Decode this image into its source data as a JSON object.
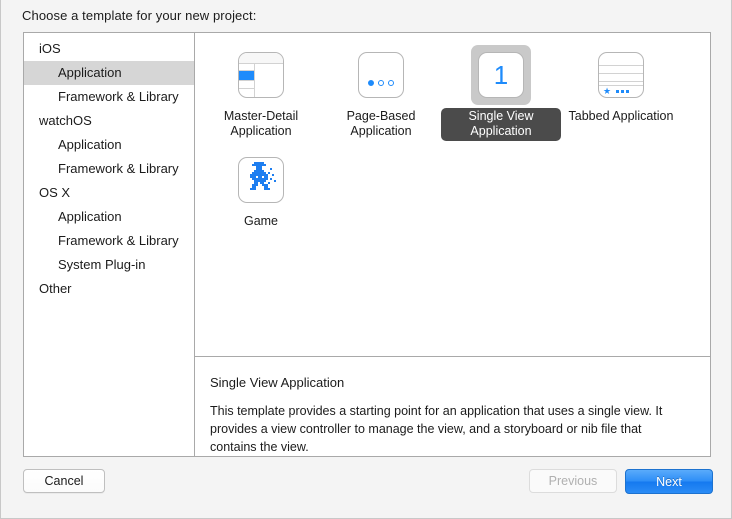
{
  "dialog": {
    "prompt": "Choose a template for your new project:"
  },
  "sidebar": {
    "items": [
      {
        "label": "iOS",
        "level": "group",
        "selected": false
      },
      {
        "label": "Application",
        "level": "child",
        "selected": true
      },
      {
        "label": "Framework & Library",
        "level": "child",
        "selected": false
      },
      {
        "label": "watchOS",
        "level": "group",
        "selected": false
      },
      {
        "label": "Application",
        "level": "child",
        "selected": false
      },
      {
        "label": "Framework & Library",
        "level": "child",
        "selected": false
      },
      {
        "label": "OS X",
        "level": "group",
        "selected": false
      },
      {
        "label": "Application",
        "level": "child",
        "selected": false
      },
      {
        "label": "Framework & Library",
        "level": "child",
        "selected": false
      },
      {
        "label": "System Plug-in",
        "level": "child",
        "selected": false
      },
      {
        "label": "Other",
        "level": "group",
        "selected": false
      }
    ]
  },
  "templates": [
    {
      "label": "Master-Detail Application",
      "icon": "master-detail-icon",
      "selected": false
    },
    {
      "label": "Page-Based Application",
      "icon": "page-based-icon",
      "selected": false
    },
    {
      "label": "Single View Application",
      "icon": "single-view-icon",
      "selected": true
    },
    {
      "label": "Tabbed Application",
      "icon": "tabbed-icon",
      "selected": false
    },
    {
      "label": "Game",
      "icon": "game-icon",
      "selected": false
    }
  ],
  "description": {
    "title": "Single View Application",
    "body": "This template provides a starting point for an application that uses a single view. It provides a view controller to manage the view, and a storyboard or nib file that contains the view."
  },
  "footer": {
    "cancel_label": "Cancel",
    "previous_label": "Previous",
    "next_label": "Next"
  },
  "colors": {
    "accent_blue": "#1e8bfb",
    "next_button_blue": "#2e8ef7",
    "selection_gray": "#d6d6d6",
    "selected_label_bg": "#4b4b4b"
  }
}
